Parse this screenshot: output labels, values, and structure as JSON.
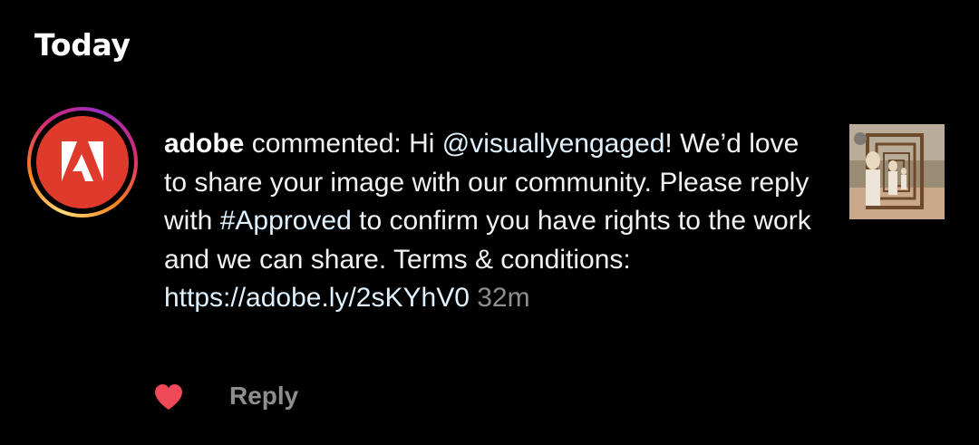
{
  "section": {
    "title": "Today"
  },
  "notification": {
    "avatar_icon": "adobe-logo-icon",
    "brand_color": "#e03a2c",
    "username": "adobe",
    "action": " commented: Hi ",
    "mention": "@visuallyengaged",
    "text_part_1": "! We’d love to share your image with our community. Please reply with ",
    "hashtag": "#Approved",
    "text_part_2": " to confirm you have rights to the work and we can share. Terms & conditions: ",
    "link": "https://adobe.ly/2sKYhV0",
    "time": "32m",
    "thumbnail_icon": "post-thumbnail-image"
  },
  "actions": {
    "like_icon": "heart-icon",
    "like_color": "#ed4956",
    "reply_label": "Reply"
  }
}
